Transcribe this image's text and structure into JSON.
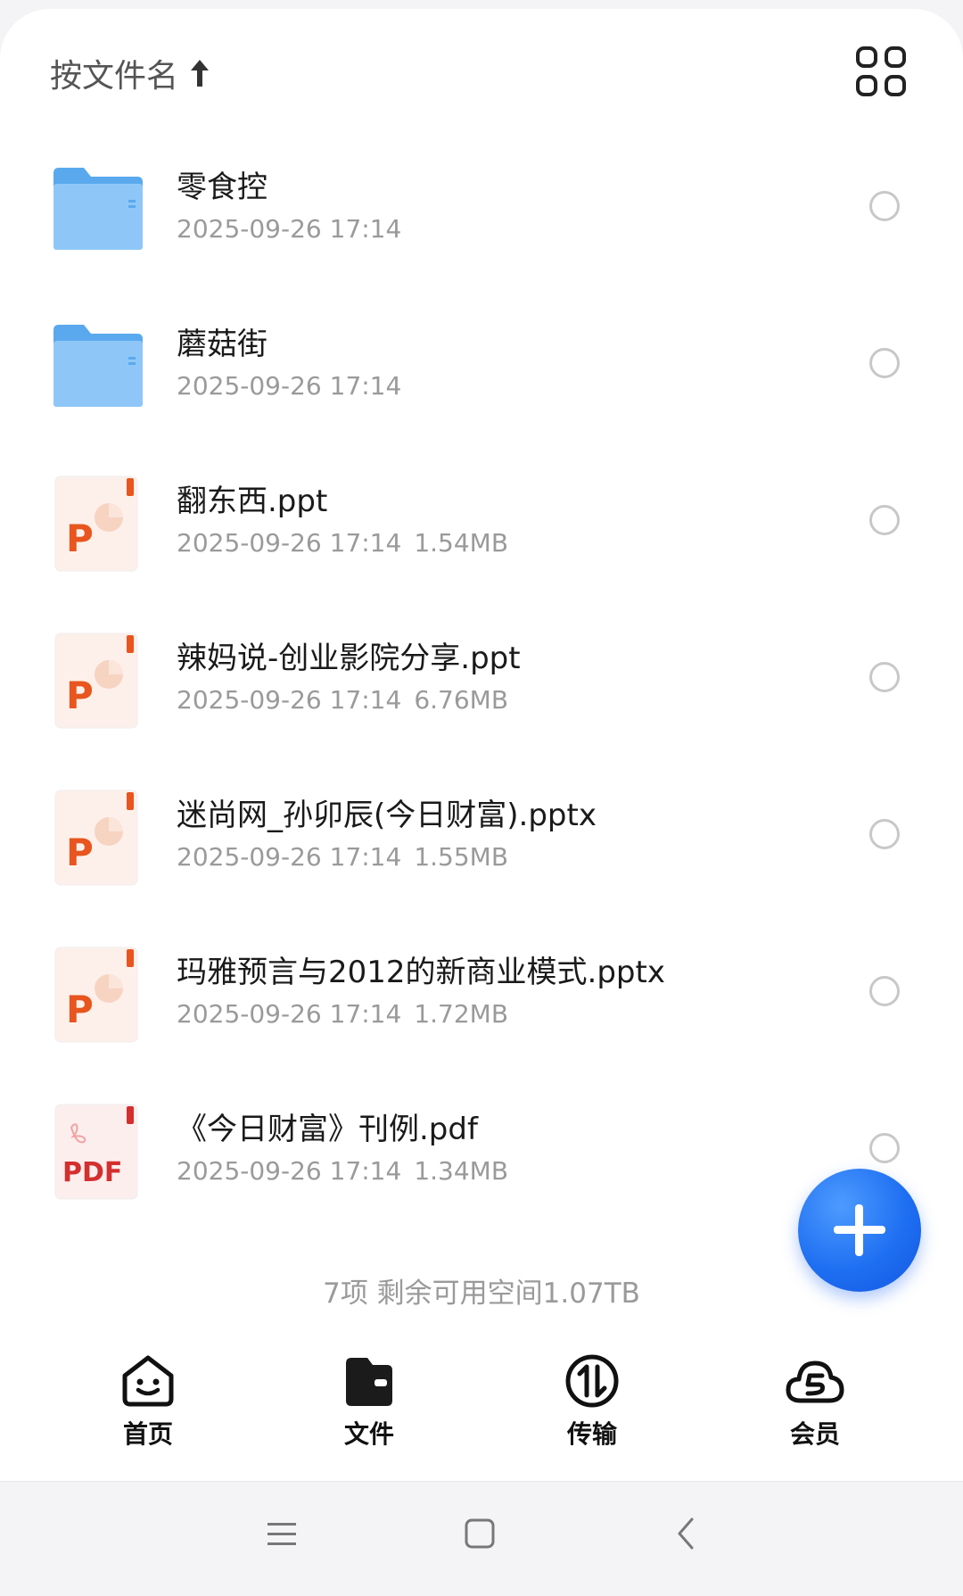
{
  "sort": {
    "label": "按文件名"
  },
  "files": [
    {
      "name": "零食控",
      "date": "2025-09-26 17:14",
      "size": "",
      "type": "folder"
    },
    {
      "name": "蘑菇街",
      "date": "2025-09-26 17:14",
      "size": "",
      "type": "folder"
    },
    {
      "name": "翻东西.ppt",
      "date": "2025-09-26 17:14",
      "size": "1.54MB",
      "type": "ppt"
    },
    {
      "name": "辣妈说-创业影院分享.ppt",
      "date": "2025-09-26 17:14",
      "size": "6.76MB",
      "type": "ppt"
    },
    {
      "name": "迷尚网_孙卯辰(今日财富).pptx",
      "date": "2025-09-26 17:14",
      "size": "1.55MB",
      "type": "ppt"
    },
    {
      "name": "玛雅预言与2012的新商业模式.pptx",
      "date": "2025-09-26 17:14",
      "size": "1.72MB",
      "type": "ppt"
    },
    {
      "name": "《今日财富》刊例.pdf",
      "date": "2025-09-26 17:14",
      "size": "1.34MB",
      "type": "pdf"
    }
  ],
  "icons": {
    "ppt_letter": "P",
    "pdf_label": "PDF"
  },
  "summary": "7项 剩余可用空间1.07TB",
  "tabs": [
    {
      "label": "首页",
      "icon": "home-smile-icon"
    },
    {
      "label": "文件",
      "icon": "wallet-folder-icon"
    },
    {
      "label": "传输",
      "icon": "transfer-icon"
    },
    {
      "label": "会员",
      "icon": "cloud-vip-icon"
    }
  ],
  "colors": {
    "accent": "#1f6ff2",
    "folder": "#5aa9ee",
    "ppt": "#e8551e",
    "pdf": "#d32f2f"
  }
}
